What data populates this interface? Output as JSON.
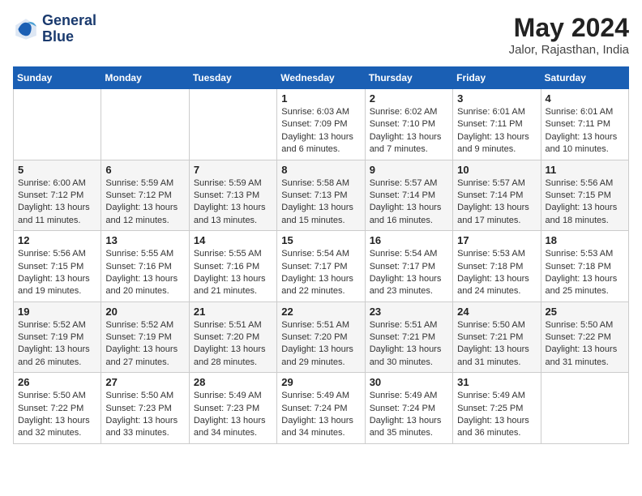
{
  "header": {
    "logo_line1": "General",
    "logo_line2": "Blue",
    "month_year": "May 2024",
    "location": "Jalor, Rajasthan, India"
  },
  "weekdays": [
    "Sunday",
    "Monday",
    "Tuesday",
    "Wednesday",
    "Thursday",
    "Friday",
    "Saturday"
  ],
  "weeks": [
    [
      {
        "day": "",
        "info": ""
      },
      {
        "day": "",
        "info": ""
      },
      {
        "day": "",
        "info": ""
      },
      {
        "day": "1",
        "info": "Sunrise: 6:03 AM\nSunset: 7:09 PM\nDaylight: 13 hours\nand 6 minutes."
      },
      {
        "day": "2",
        "info": "Sunrise: 6:02 AM\nSunset: 7:10 PM\nDaylight: 13 hours\nand 7 minutes."
      },
      {
        "day": "3",
        "info": "Sunrise: 6:01 AM\nSunset: 7:11 PM\nDaylight: 13 hours\nand 9 minutes."
      },
      {
        "day": "4",
        "info": "Sunrise: 6:01 AM\nSunset: 7:11 PM\nDaylight: 13 hours\nand 10 minutes."
      }
    ],
    [
      {
        "day": "5",
        "info": "Sunrise: 6:00 AM\nSunset: 7:12 PM\nDaylight: 13 hours\nand 11 minutes."
      },
      {
        "day": "6",
        "info": "Sunrise: 5:59 AM\nSunset: 7:12 PM\nDaylight: 13 hours\nand 12 minutes."
      },
      {
        "day": "7",
        "info": "Sunrise: 5:59 AM\nSunset: 7:13 PM\nDaylight: 13 hours\nand 13 minutes."
      },
      {
        "day": "8",
        "info": "Sunrise: 5:58 AM\nSunset: 7:13 PM\nDaylight: 13 hours\nand 15 minutes."
      },
      {
        "day": "9",
        "info": "Sunrise: 5:57 AM\nSunset: 7:14 PM\nDaylight: 13 hours\nand 16 minutes."
      },
      {
        "day": "10",
        "info": "Sunrise: 5:57 AM\nSunset: 7:14 PM\nDaylight: 13 hours\nand 17 minutes."
      },
      {
        "day": "11",
        "info": "Sunrise: 5:56 AM\nSunset: 7:15 PM\nDaylight: 13 hours\nand 18 minutes."
      }
    ],
    [
      {
        "day": "12",
        "info": "Sunrise: 5:56 AM\nSunset: 7:15 PM\nDaylight: 13 hours\nand 19 minutes."
      },
      {
        "day": "13",
        "info": "Sunrise: 5:55 AM\nSunset: 7:16 PM\nDaylight: 13 hours\nand 20 minutes."
      },
      {
        "day": "14",
        "info": "Sunrise: 5:55 AM\nSunset: 7:16 PM\nDaylight: 13 hours\nand 21 minutes."
      },
      {
        "day": "15",
        "info": "Sunrise: 5:54 AM\nSunset: 7:17 PM\nDaylight: 13 hours\nand 22 minutes."
      },
      {
        "day": "16",
        "info": "Sunrise: 5:54 AM\nSunset: 7:17 PM\nDaylight: 13 hours\nand 23 minutes."
      },
      {
        "day": "17",
        "info": "Sunrise: 5:53 AM\nSunset: 7:18 PM\nDaylight: 13 hours\nand 24 minutes."
      },
      {
        "day": "18",
        "info": "Sunrise: 5:53 AM\nSunset: 7:18 PM\nDaylight: 13 hours\nand 25 minutes."
      }
    ],
    [
      {
        "day": "19",
        "info": "Sunrise: 5:52 AM\nSunset: 7:19 PM\nDaylight: 13 hours\nand 26 minutes."
      },
      {
        "day": "20",
        "info": "Sunrise: 5:52 AM\nSunset: 7:19 PM\nDaylight: 13 hours\nand 27 minutes."
      },
      {
        "day": "21",
        "info": "Sunrise: 5:51 AM\nSunset: 7:20 PM\nDaylight: 13 hours\nand 28 minutes."
      },
      {
        "day": "22",
        "info": "Sunrise: 5:51 AM\nSunset: 7:20 PM\nDaylight: 13 hours\nand 29 minutes."
      },
      {
        "day": "23",
        "info": "Sunrise: 5:51 AM\nSunset: 7:21 PM\nDaylight: 13 hours\nand 30 minutes."
      },
      {
        "day": "24",
        "info": "Sunrise: 5:50 AM\nSunset: 7:21 PM\nDaylight: 13 hours\nand 31 minutes."
      },
      {
        "day": "25",
        "info": "Sunrise: 5:50 AM\nSunset: 7:22 PM\nDaylight: 13 hours\nand 31 minutes."
      }
    ],
    [
      {
        "day": "26",
        "info": "Sunrise: 5:50 AM\nSunset: 7:22 PM\nDaylight: 13 hours\nand 32 minutes."
      },
      {
        "day": "27",
        "info": "Sunrise: 5:50 AM\nSunset: 7:23 PM\nDaylight: 13 hours\nand 33 minutes."
      },
      {
        "day": "28",
        "info": "Sunrise: 5:49 AM\nSunset: 7:23 PM\nDaylight: 13 hours\nand 34 minutes."
      },
      {
        "day": "29",
        "info": "Sunrise: 5:49 AM\nSunset: 7:24 PM\nDaylight: 13 hours\nand 34 minutes."
      },
      {
        "day": "30",
        "info": "Sunrise: 5:49 AM\nSunset: 7:24 PM\nDaylight: 13 hours\nand 35 minutes."
      },
      {
        "day": "31",
        "info": "Sunrise: 5:49 AM\nSunset: 7:25 PM\nDaylight: 13 hours\nand 36 minutes."
      },
      {
        "day": "",
        "info": ""
      }
    ]
  ]
}
